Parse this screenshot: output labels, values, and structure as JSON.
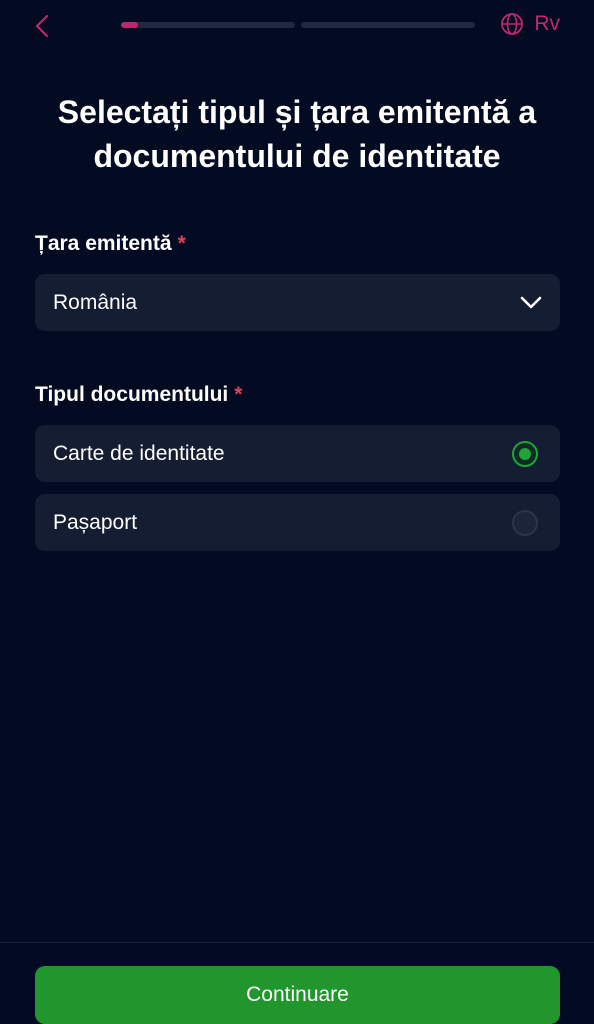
{
  "header": {
    "progress_steps": [
      0.1,
      0
    ],
    "language_label": "Rv"
  },
  "page": {
    "title": "Selectați tipul și țara emitentă a documentului de identitate"
  },
  "country_field": {
    "label": "Țara emitentă",
    "required_mark": "*",
    "selected_value": "România"
  },
  "document_type_field": {
    "label": "Tipul documentului",
    "required_mark": "*",
    "options": [
      {
        "label": "Carte de identitate",
        "selected": true
      },
      {
        "label": "Pașaport",
        "selected": false
      }
    ]
  },
  "footer": {
    "continue_label": "Continuare"
  },
  "colors": {
    "background": "#020b21",
    "accent": "#c0266f",
    "primary_button": "#21962d",
    "required": "#e0415a"
  },
  "icons": {
    "back": "chevron-left-icon",
    "language": "globe-icon",
    "dropdown": "chevron-down-icon"
  }
}
